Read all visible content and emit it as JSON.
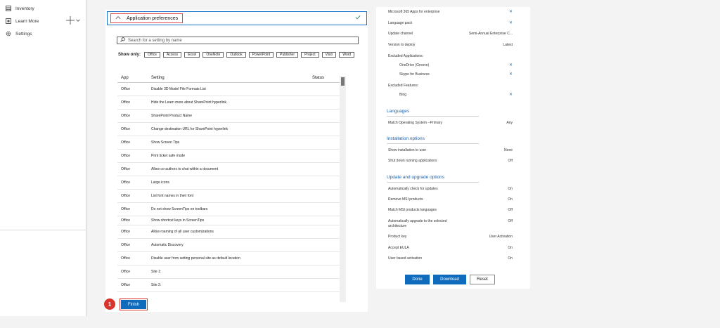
{
  "sidebar": {
    "items": [
      {
        "label": "Inventory",
        "icon": "inventory-icon"
      },
      {
        "label": "Learn More",
        "icon": "learn-more-icon"
      },
      {
        "label": "Settings",
        "icon": "gear-icon"
      }
    ]
  },
  "app_prefs": {
    "title": "Application preferences",
    "search_placeholder": "Search for a setting by name",
    "filter_label": "Show only:",
    "filters": [
      "Office",
      "Access",
      "Excel",
      "OneNote",
      "Outlook",
      "PowerPoint",
      "Publisher",
      "Project",
      "Visio",
      "Word"
    ],
    "columns": {
      "app": "App",
      "setting": "Setting",
      "status": "Status"
    },
    "rows": [
      {
        "app": "Office",
        "setting": "Disable 3D Model File Formats List"
      },
      {
        "app": "Office",
        "setting": "Hide the Learn more about SharePoint hyperlink"
      },
      {
        "app": "Office",
        "setting": "SharePoint Product Name"
      },
      {
        "app": "Office",
        "setting": "Change destination URL for SharePoint hyperlink"
      },
      {
        "app": "Office",
        "setting": "Show Screen Tips"
      },
      {
        "app": "Office",
        "setting": "Print ticket safe mode"
      },
      {
        "app": "Office",
        "setting": "Allow co-authors to chat within a document"
      },
      {
        "app": "Office",
        "setting": "Large icons"
      },
      {
        "app": "Office",
        "setting": "List font names in their font"
      },
      {
        "app": "Office",
        "setting": "Do not show ScreenTips on toolbars"
      },
      {
        "app": "Office",
        "setting": "Show shortcut keys in ScreenTips"
      },
      {
        "app": "Office",
        "setting": "Allow roaming of all user customizations"
      },
      {
        "app": "Office",
        "setting": "Automatic Discovery"
      },
      {
        "app": "Office",
        "setting": "Disable user from setting personal site as default location"
      },
      {
        "app": "Office",
        "setting": "Site 1:"
      },
      {
        "app": "Office",
        "setting": "Site 2:"
      }
    ],
    "step_number": "1",
    "finish_label": "Finish"
  },
  "summary": {
    "products": [
      {
        "label": "Microsoft 365 Apps for enterprise"
      },
      {
        "label": "Language pack"
      }
    ],
    "update_channel": {
      "label": "Update channel",
      "value": "Semi-Annual Enterprise C..."
    },
    "version": {
      "label": "Version to deploy",
      "value": "Latest"
    },
    "excluded_apps_label": "Excluded Applications:",
    "excluded_apps": [
      "OneDrive (Groove)",
      "Skype for Business"
    ],
    "excluded_features_label": "Excluded Features:",
    "excluded_features": [
      "Bing"
    ],
    "languages": {
      "title": "Languages",
      "match_os": {
        "label": "Match Operating System --Primary",
        "value": "Any"
      }
    },
    "installation": {
      "title": "Installation options",
      "show_install": {
        "label": "Show installation to user",
        "value": "None"
      },
      "shut_down": {
        "label": "Shut down running applications",
        "value": "Off"
      }
    },
    "updates": {
      "title": "Update and upgrade options",
      "auto_check": {
        "label": "Automatically check for updates",
        "value": "On"
      },
      "remove_msi": {
        "label": "Remove MSI products",
        "value": "On"
      },
      "match_msi": {
        "label": "Match MSI products languages",
        "value": "Off"
      },
      "auto_upgrade": {
        "label": "Automatically upgrade to the selected architecture",
        "value": "Off"
      },
      "product_key": {
        "label": "Product key",
        "value": "User Activation"
      },
      "accept_eula": {
        "label": "Accept EULA",
        "value": "On"
      },
      "user_activation": {
        "label": "User based activation",
        "value": "On"
      }
    },
    "buttons": {
      "done": "Done",
      "download": "Download",
      "reset": "Reset"
    }
  },
  "colors": {
    "accent": "#0f6cbd",
    "highlight": "#d9342b",
    "link": "#1a73c9"
  }
}
